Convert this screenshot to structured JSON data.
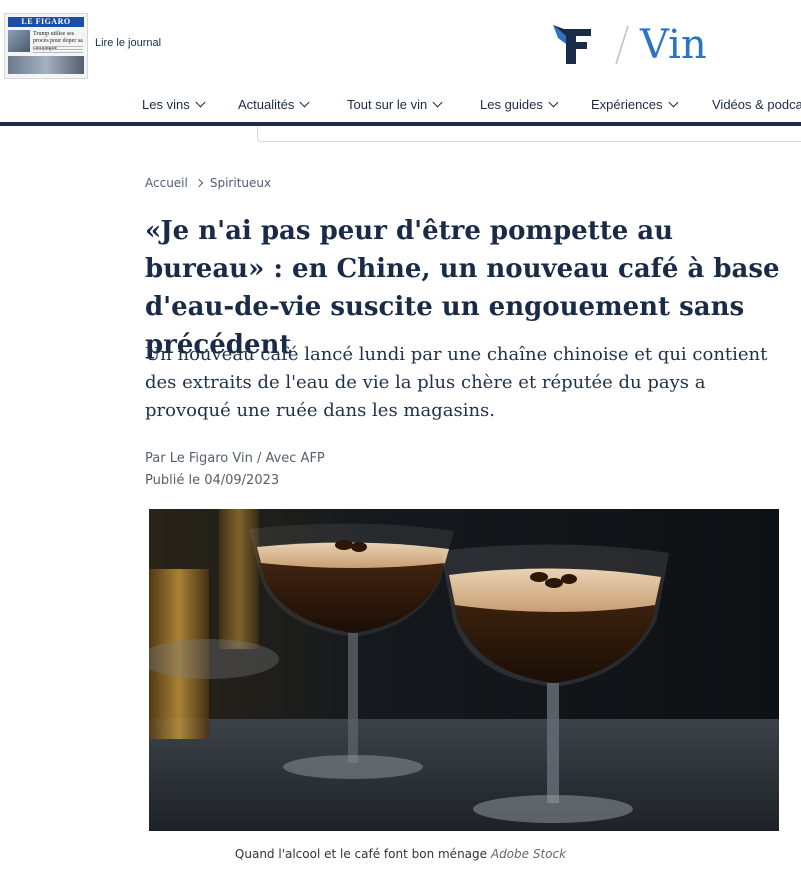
{
  "journal": {
    "masthead": "LE FIGARO",
    "headline": "Trump utilise ses procès pour doper sa campagne",
    "link_label": "Lire le journal"
  },
  "brand": {
    "section": "Vin",
    "colors": {
      "logo": "#1a2b47",
      "accent": "#2c73c6"
    }
  },
  "nav": {
    "items": [
      {
        "label": "Les vins",
        "icon": "chevron-down-icon"
      },
      {
        "label": "Actualités",
        "icon": "chevron-down-icon"
      },
      {
        "label": "Tout sur le vin",
        "icon": "chevron-down-icon"
      },
      {
        "label": "Les guides",
        "icon": "chevron-down-icon"
      },
      {
        "label": "Expériences",
        "icon": "chevron-down-icon"
      },
      {
        "label": "Vidéos & podca",
        "icon": null
      }
    ]
  },
  "breadcrumb": {
    "home": "Accueil",
    "section": "Spiritueux"
  },
  "article": {
    "title": "«Je n'ai pas peur d'être pompette au bureau» : en Chine, un nouveau café à base d'eau-de-vie suscite un engouement sans précédent",
    "standfirst": "Un nouveau café lancé lundi par une chaîne chinoise et qui contient des extraits de l'eau de vie la plus chère et réputée du pays a provoqué une ruée dans les magasins.",
    "byline": "Par Le Figaro Vin / Avec AFP",
    "published": "Publié le 04/09/2023"
  },
  "figure": {
    "caption": "Quand l'alcool et le café font bon ménage",
    "credit": "Adobe Stock"
  }
}
